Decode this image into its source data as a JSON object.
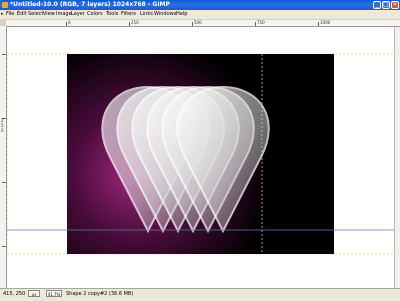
{
  "window": {
    "title": "*Untitled-10.0 (RGB, 7 layers) 1024x768 - GIMP"
  },
  "menubar": {
    "items": [
      "File",
      "Edit",
      "Select",
      "View",
      "Image",
      "Layer",
      "Colors",
      "Tools",
      "Filters",
      "Links",
      "Windows",
      "Help"
    ]
  },
  "rulers": {
    "top_labels": [
      "0",
      "250",
      "500",
      "750",
      "1000"
    ],
    "left_labels": [
      "2",
      "5",
      "0"
    ]
  },
  "status": {
    "coordinates": "415, 250",
    "unit": "px",
    "zoom": "41.7%",
    "message": "Shape 2 copy#2 (36.6 MB)"
  },
  "colors": {
    "titlebar": "#2d72e4",
    "canvas_bg": "#000000",
    "glow": "#8a1c6e",
    "guide": "#b8b84a"
  }
}
